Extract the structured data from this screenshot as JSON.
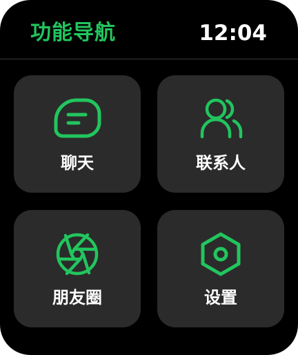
{
  "theme": {
    "accent": "#22C55E",
    "background": "#000000",
    "tile": "#2B2B2B",
    "text": "#FFFFFF"
  },
  "header": {
    "title": "功能导航",
    "time": "12:04"
  },
  "menu": {
    "items": [
      {
        "label": "聊天",
        "icon": "chat-bubble-icon"
      },
      {
        "label": "联系人",
        "icon": "contacts-icon"
      },
      {
        "label": "朋友圈",
        "icon": "aperture-icon"
      },
      {
        "label": "设置",
        "icon": "settings-hexagon-icon"
      }
    ]
  }
}
